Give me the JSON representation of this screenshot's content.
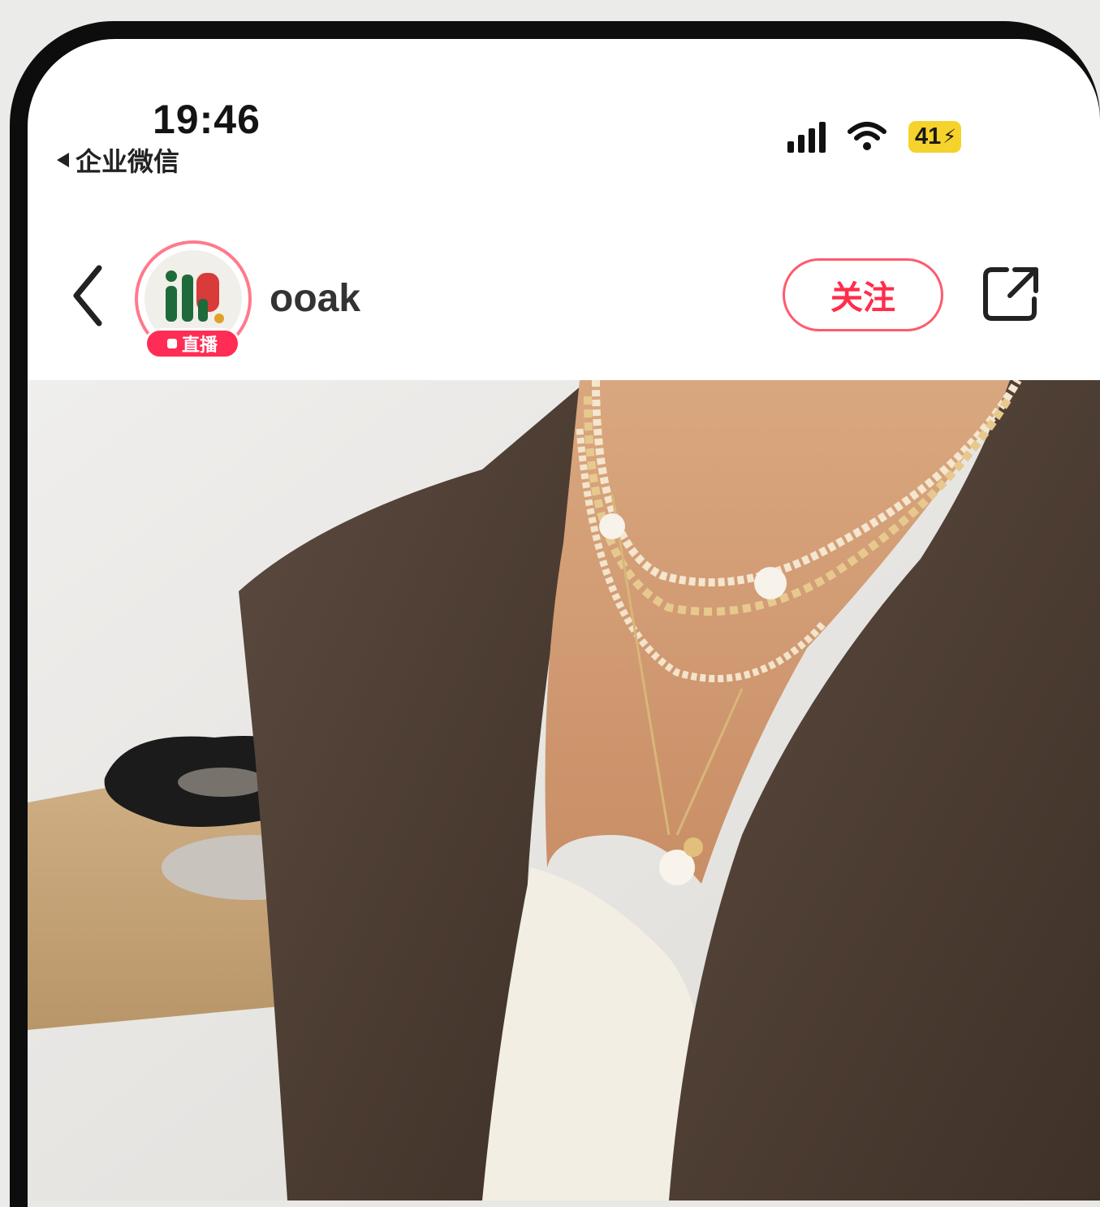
{
  "status_bar": {
    "time": "19:46",
    "back_app_label": "企业微信",
    "battery": "41",
    "icons": [
      "cellular-signal-icon",
      "wifi-icon",
      "battery-charging-icon"
    ]
  },
  "header": {
    "username": "ooak",
    "live_badge": "直播",
    "follow_label": "关注",
    "icons": [
      "back-chevron-icon",
      "share-icon"
    ]
  },
  "colors": {
    "accent": "#ff2d4a",
    "live_badge": "#ff2d55",
    "battery": "#f5d22c"
  },
  "content": {
    "media": "photo"
  }
}
